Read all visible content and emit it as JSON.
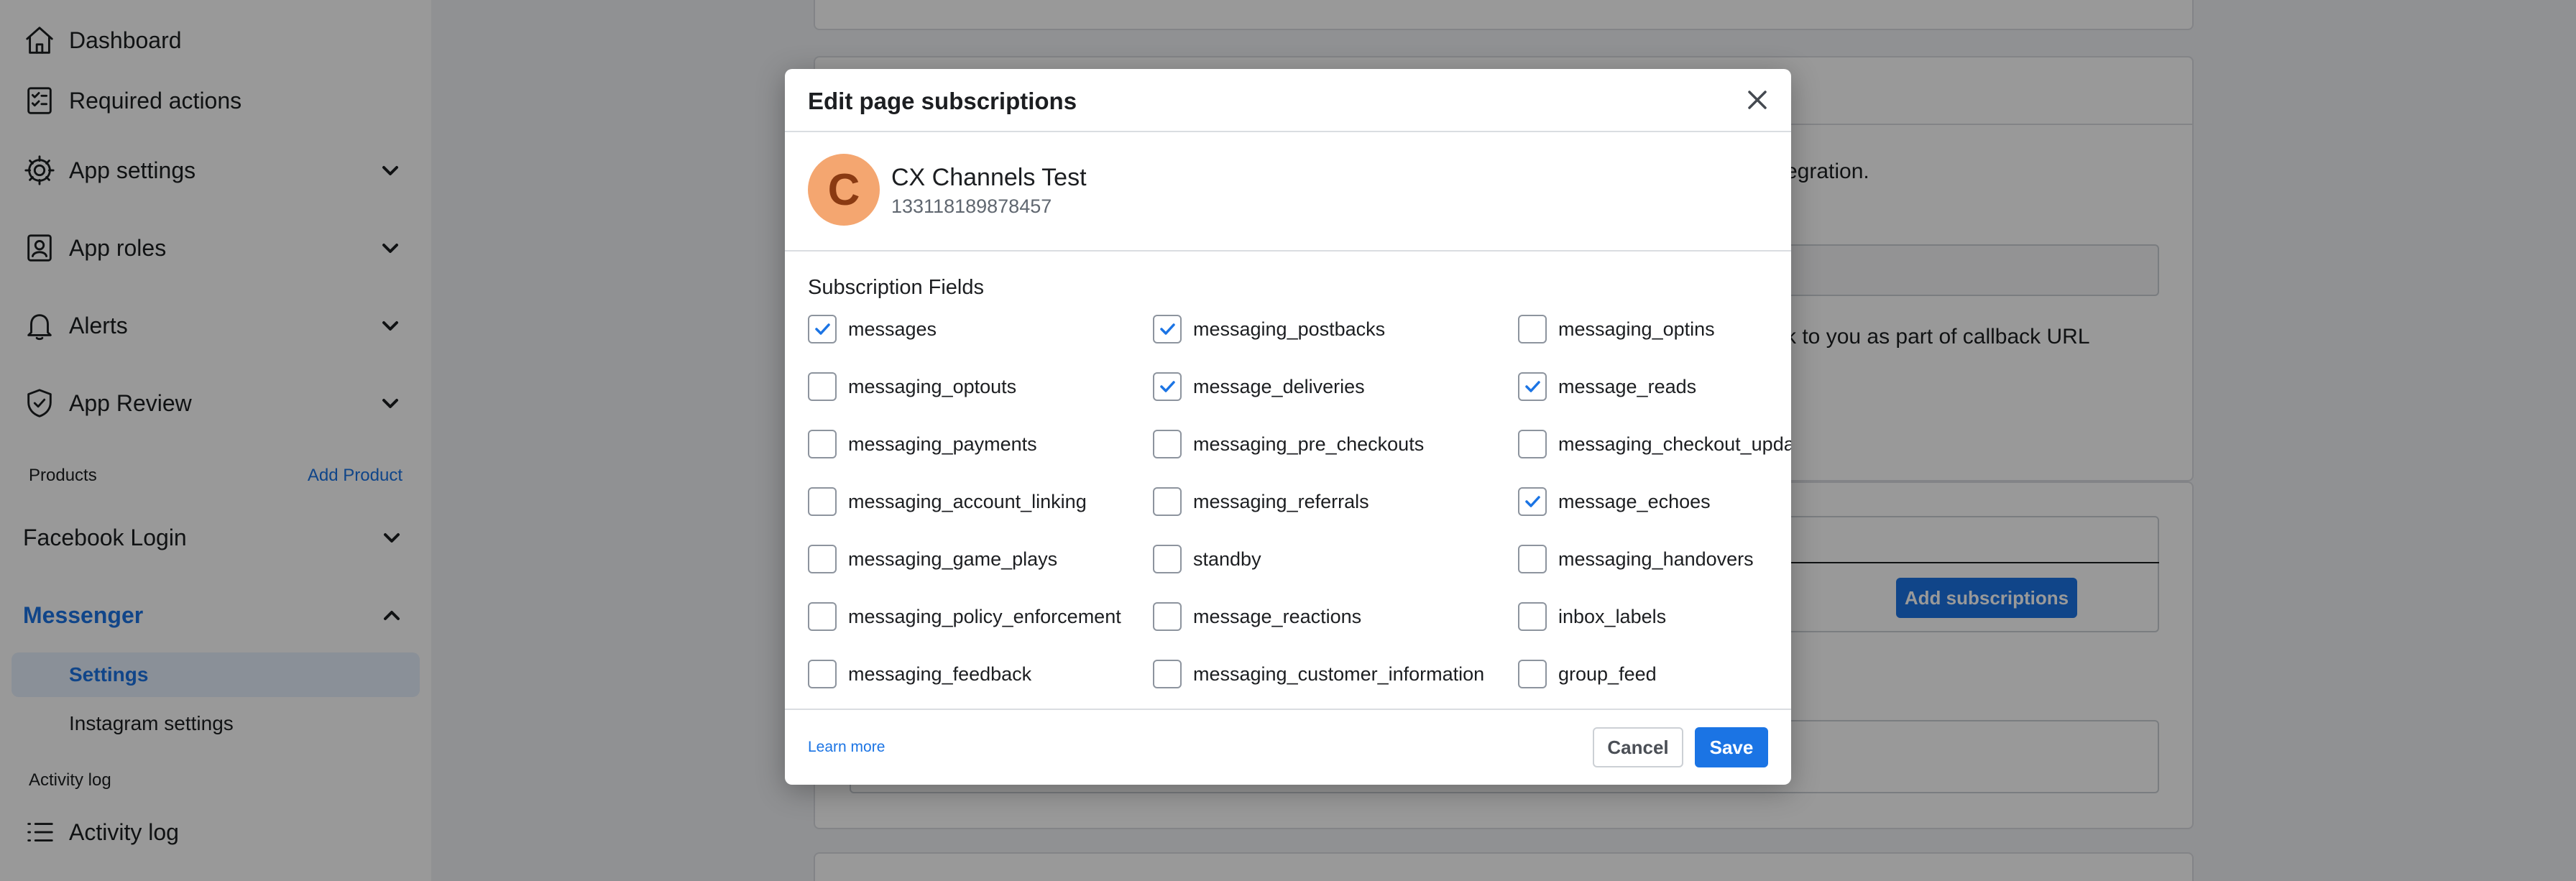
{
  "sidebar": {
    "dashboard": "Dashboard",
    "required_actions": "Required actions",
    "app_settings": "App settings",
    "app_roles": "App roles",
    "alerts": "Alerts",
    "app_review": "App Review",
    "products_label": "Products",
    "add_product": "Add Product",
    "facebook_login": "Facebook Login",
    "messenger": "Messenger",
    "settings": "Settings",
    "instagram_settings": "Instagram settings",
    "activity_log_label": "Activity log",
    "activity_log": "Activity log"
  },
  "background": {
    "text_integration": "egration.",
    "text_callback": "k to you as part of callback URL",
    "add_subscriptions": "Add subscriptions"
  },
  "modal": {
    "title": "Edit page subscriptions",
    "page": {
      "avatar_letter": "C",
      "name": "CX Channels Test",
      "id": "133118189878457"
    },
    "fields_title": "Subscription Fields",
    "fields": [
      {
        "label": "messages",
        "checked": true
      },
      {
        "label": "messaging_postbacks",
        "checked": true
      },
      {
        "label": "messaging_optins",
        "checked": false
      },
      {
        "label": "messaging_optouts",
        "checked": false
      },
      {
        "label": "message_deliveries",
        "checked": true
      },
      {
        "label": "message_reads",
        "checked": true
      },
      {
        "label": "messaging_payments",
        "checked": false
      },
      {
        "label": "messaging_pre_checkouts",
        "checked": false
      },
      {
        "label": "messaging_checkout_upda",
        "checked": false
      },
      {
        "label": "messaging_account_linking",
        "checked": false
      },
      {
        "label": "messaging_referrals",
        "checked": false
      },
      {
        "label": "message_echoes",
        "checked": true
      },
      {
        "label": "messaging_game_plays",
        "checked": false
      },
      {
        "label": "standby",
        "checked": false
      },
      {
        "label": "messaging_handovers",
        "checked": false
      },
      {
        "label": "messaging_policy_enforcement",
        "checked": false
      },
      {
        "label": "message_reactions",
        "checked": false
      },
      {
        "label": "inbox_labels",
        "checked": false
      },
      {
        "label": "messaging_feedback",
        "checked": false
      },
      {
        "label": "messaging_customer_information",
        "checked": false
      },
      {
        "label": "group_feed",
        "checked": false
      }
    ],
    "learn_more": "Learn more",
    "cancel": "Cancel",
    "save": "Save"
  },
  "colors": {
    "accent": "#1b74e4",
    "avatar_bg": "#f4a670",
    "avatar_letter": "#8a3a12"
  }
}
